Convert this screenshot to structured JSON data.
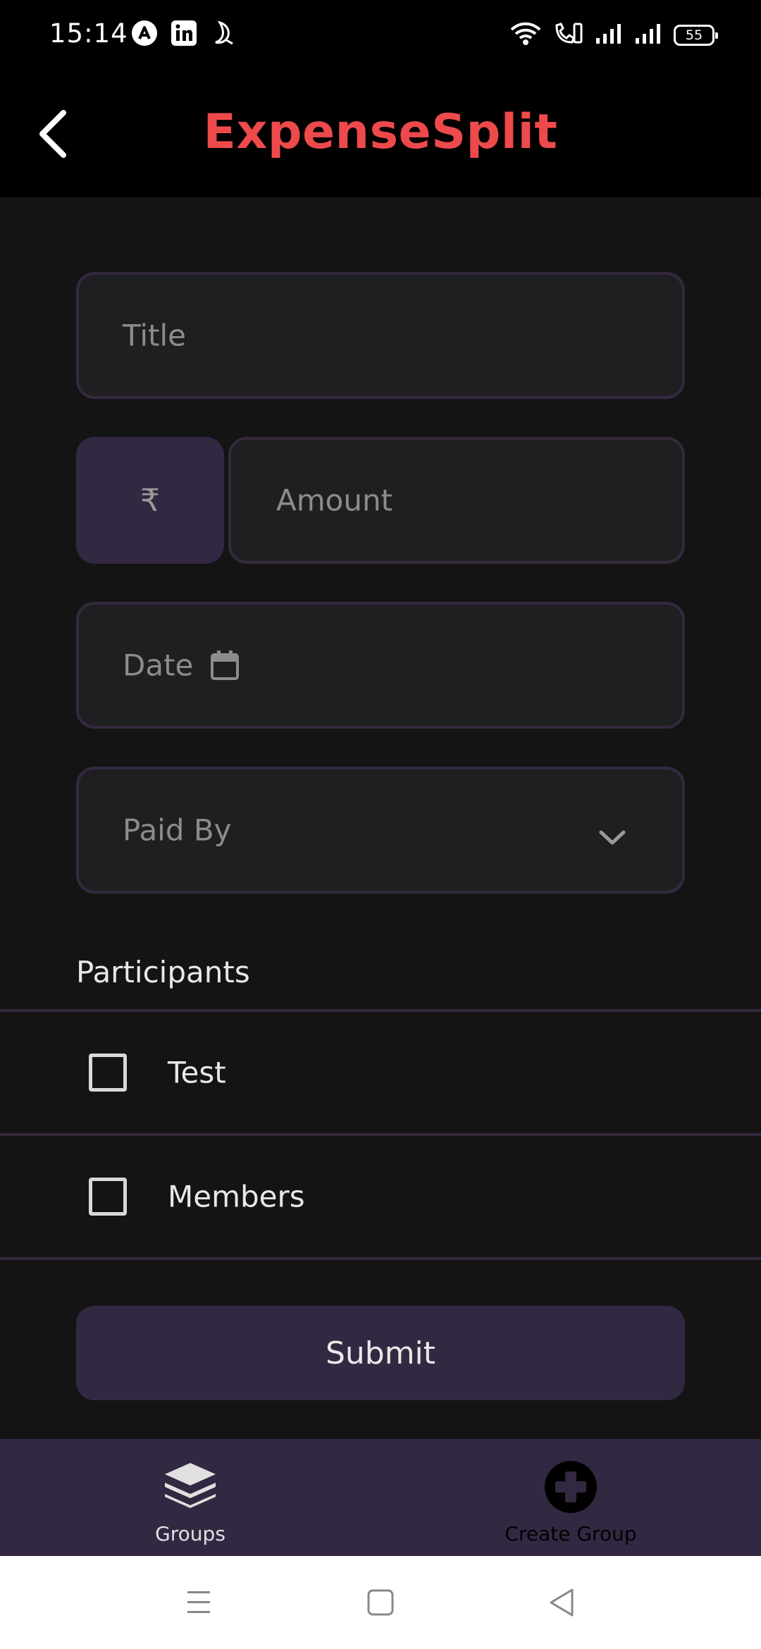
{
  "status_bar": {
    "time": "15:14",
    "battery": "55",
    "left_icons": [
      "app-notification-icon",
      "linkedin-icon",
      "moon-icon"
    ],
    "right_icons": [
      "wifi-icon",
      "wifi-calling-icon",
      "signal-icon",
      "signal-icon"
    ]
  },
  "app_bar": {
    "title": "ExpenseSplit",
    "title_color": "#ee4a4c"
  },
  "form": {
    "title_placeholder": "Title",
    "currency_symbol": "₹",
    "amount_placeholder": "Amount",
    "date_placeholder": "Date",
    "paid_by_placeholder": "Paid By",
    "participants_label": "Participants",
    "participants": [
      {
        "name": "Test",
        "checked": false
      },
      {
        "name": "Members",
        "checked": false
      }
    ],
    "submit_label": "Submit"
  },
  "bottom_nav": {
    "items": [
      {
        "label": "Groups",
        "icon": "layers-icon"
      },
      {
        "label": "Create Group",
        "icon": "plus-circle-icon"
      }
    ]
  },
  "colors": {
    "background": "#141415",
    "field_bg": "#1f1f21",
    "accent": "#332841",
    "border": "#34293f"
  }
}
